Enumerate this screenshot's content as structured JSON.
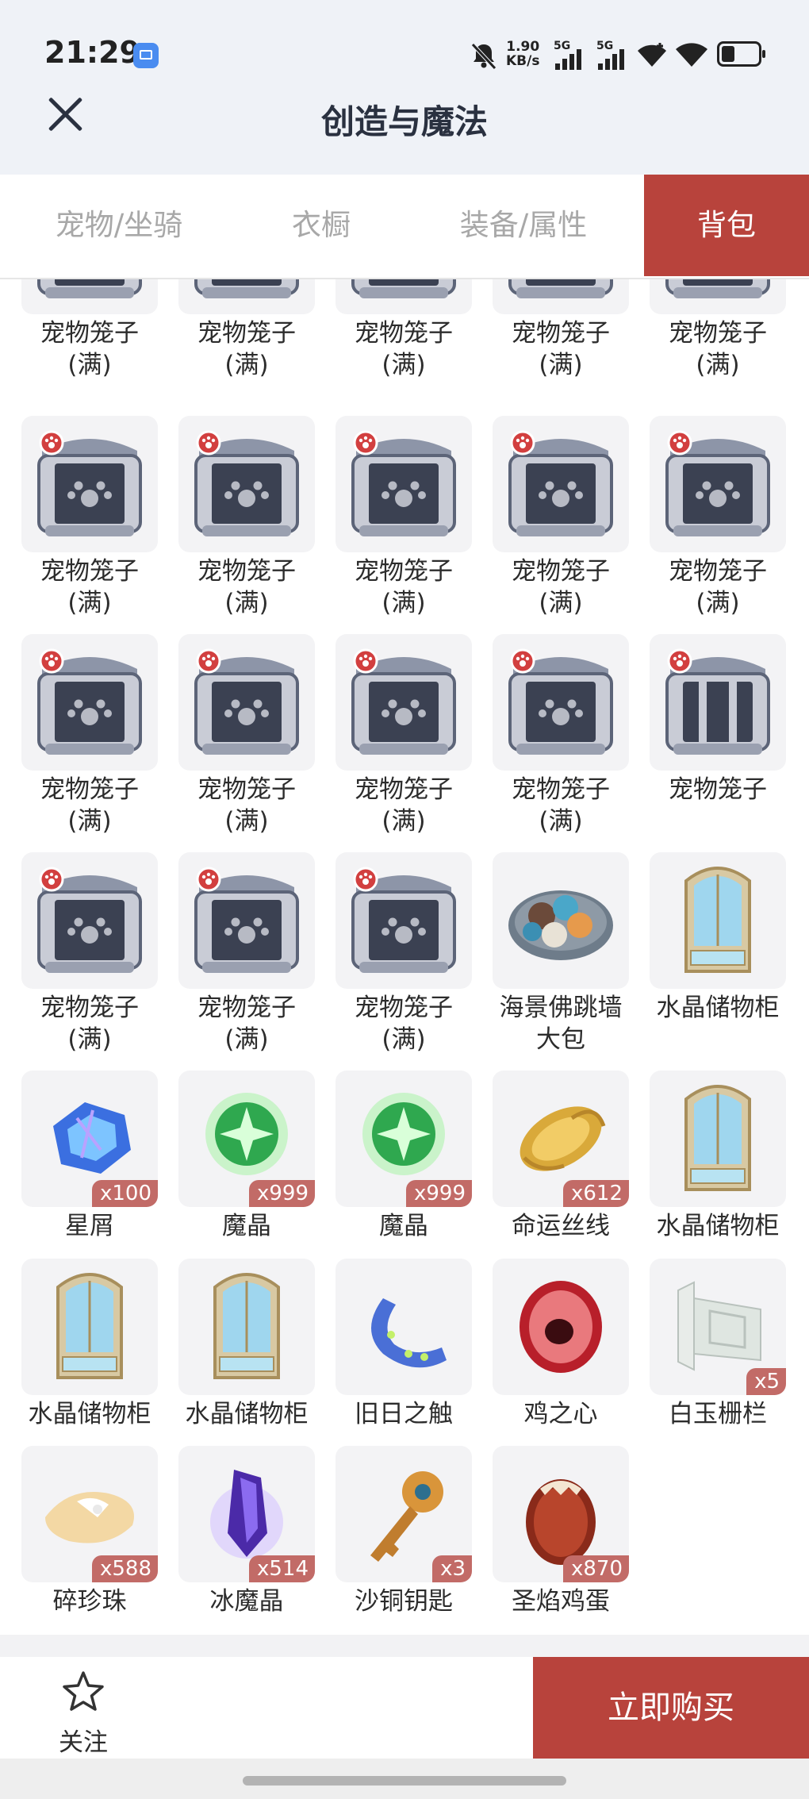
{
  "status_bar": {
    "time": "21:29",
    "net_speed_value": "1.90",
    "net_speed_unit": "KB/s",
    "sim1_label": "5G",
    "sim2_label": "5G",
    "icons": [
      "app-notification-icon",
      "mute-bell-icon",
      "wifi-icon",
      "battery-icon"
    ]
  },
  "header": {
    "title": "创造与魔法",
    "close_icon": "close-icon"
  },
  "tabs": [
    {
      "label": "宠物/坐骑",
      "active": false
    },
    {
      "label": "衣橱",
      "active": false
    },
    {
      "label": "装备/属性",
      "active": false
    },
    {
      "label": "背包",
      "active": true
    }
  ],
  "items": [
    {
      "name": "宠物笼子",
      "sub": "(满)",
      "icon": "pet-cage-full-icon",
      "qty": ""
    },
    {
      "name": "宠物笼子",
      "sub": "(满)",
      "icon": "pet-cage-full-icon",
      "qty": ""
    },
    {
      "name": "宠物笼子",
      "sub": "(满)",
      "icon": "pet-cage-full-icon",
      "qty": ""
    },
    {
      "name": "宠物笼子",
      "sub": "(满)",
      "icon": "pet-cage-full-icon",
      "qty": ""
    },
    {
      "name": "宠物笼子",
      "sub": "(满)",
      "icon": "pet-cage-full-icon",
      "qty": ""
    },
    {
      "name": "宠物笼子",
      "sub": "(满)",
      "icon": "pet-cage-full-icon",
      "qty": ""
    },
    {
      "name": "宠物笼子",
      "sub": "(满)",
      "icon": "pet-cage-full-icon",
      "qty": ""
    },
    {
      "name": "宠物笼子",
      "sub": "(满)",
      "icon": "pet-cage-full-icon",
      "qty": ""
    },
    {
      "name": "宠物笼子",
      "sub": "(满)",
      "icon": "pet-cage-full-icon",
      "qty": ""
    },
    {
      "name": "宠物笼子",
      "sub": "(满)",
      "icon": "pet-cage-full-icon",
      "qty": ""
    },
    {
      "name": "宠物笼子",
      "sub": "(满)",
      "icon": "pet-cage-full-icon",
      "qty": ""
    },
    {
      "name": "宠物笼子",
      "sub": "(满)",
      "icon": "pet-cage-full-icon",
      "qty": ""
    },
    {
      "name": "宠物笼子",
      "sub": "(满)",
      "icon": "pet-cage-full-icon",
      "qty": ""
    },
    {
      "name": "宠物笼子",
      "sub": "(满)",
      "icon": "pet-cage-full-icon",
      "qty": ""
    },
    {
      "name": "宠物笼子",
      "sub": "",
      "icon": "pet-cage-empty-icon",
      "qty": ""
    },
    {
      "name": "宠物笼子",
      "sub": "(满)",
      "icon": "pet-cage-full-icon",
      "qty": ""
    },
    {
      "name": "宠物笼子",
      "sub": "(满)",
      "icon": "pet-cage-full-icon",
      "qty": ""
    },
    {
      "name": "宠物笼子",
      "sub": "(满)",
      "icon": "pet-cage-full-icon",
      "qty": ""
    },
    {
      "name": "海景佛跳墙",
      "sub": "大包",
      "icon": "seafood-dish-icon",
      "qty": ""
    },
    {
      "name": "水晶储物柜",
      "sub": "",
      "icon": "crystal-cabinet-icon",
      "qty": ""
    },
    {
      "name": "星屑",
      "sub": "",
      "icon": "stardust-icon",
      "qty": "x100"
    },
    {
      "name": "魔晶",
      "sub": "",
      "icon": "magic-crystal-icon",
      "qty": "x999"
    },
    {
      "name": "魔晶",
      "sub": "",
      "icon": "magic-crystal-icon",
      "qty": "x999"
    },
    {
      "name": "命运丝线",
      "sub": "",
      "icon": "fate-thread-icon",
      "qty": "x612"
    },
    {
      "name": "水晶储物柜",
      "sub": "",
      "icon": "crystal-cabinet-icon",
      "qty": ""
    },
    {
      "name": "水晶储物柜",
      "sub": "",
      "icon": "crystal-cabinet-icon",
      "qty": ""
    },
    {
      "name": "水晶储物柜",
      "sub": "",
      "icon": "crystal-cabinet-icon",
      "qty": ""
    },
    {
      "name": "旧日之触",
      "sub": "",
      "icon": "tentacle-icon",
      "qty": ""
    },
    {
      "name": "鸡之心",
      "sub": "",
      "icon": "chicken-heart-icon",
      "qty": ""
    },
    {
      "name": "白玉栅栏",
      "sub": "",
      "icon": "jade-fence-icon",
      "qty": "x5"
    },
    {
      "name": "碎珍珠",
      "sub": "",
      "icon": "broken-pearl-icon",
      "qty": "x588"
    },
    {
      "name": "冰魔晶",
      "sub": "",
      "icon": "ice-crystal-icon",
      "qty": "x514"
    },
    {
      "name": "沙铜钥匙",
      "sub": "",
      "icon": "bronze-key-icon",
      "qty": "x3"
    },
    {
      "name": "圣焰鸡蛋",
      "sub": "",
      "icon": "flame-egg-icon",
      "qty": "x870"
    }
  ],
  "bottom_bar": {
    "follow_label": "关注",
    "follow_icon": "star-outline-icon",
    "buy_label": "立即购买"
  },
  "colors": {
    "accent": "#b8433c",
    "qty_badge": "#c26b67",
    "header_bg": "#eff2f7",
    "tile_bg": "#f3f3f5"
  }
}
